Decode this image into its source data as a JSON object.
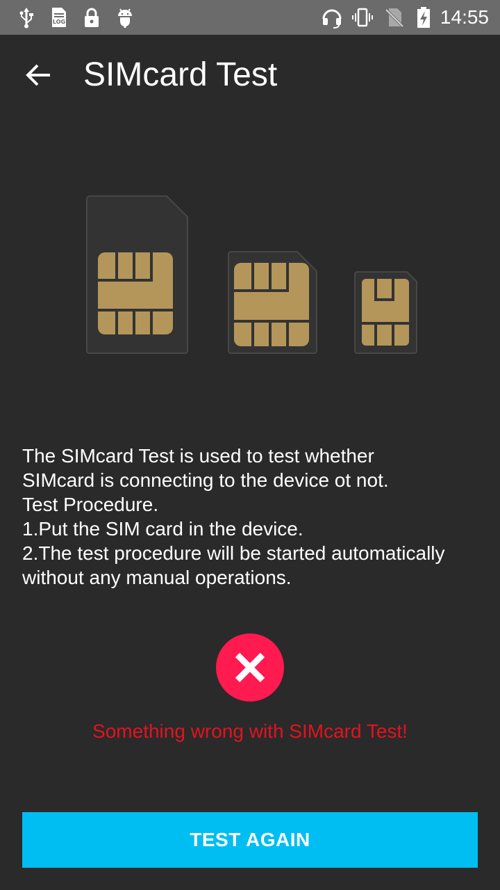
{
  "status_bar": {
    "time": "14:55",
    "left_icons": [
      "usb-icon",
      "log-icon",
      "lock-icon",
      "android-debug-icon"
    ],
    "right_icons": [
      "headset-icon",
      "vibrate-icon",
      "no-sim-icon",
      "battery-charging-icon"
    ]
  },
  "app_bar": {
    "back_icon": "arrow-back-icon",
    "title": "SIMcard Test"
  },
  "illustration": {
    "items": [
      "standard-sim-icon",
      "micro-sim-icon",
      "nano-sim-icon"
    ],
    "chip_color": "#b4965a",
    "card_color": "#333333"
  },
  "description": {
    "lines": [
      "The SIMcard Test is used to test whether",
      "SIMcard is connecting to the device ot not.",
      "Test Procedure.",
      "1.Put the SIM card in the device.",
      "2.The test procedure will be started automatically",
      "without any manual operations."
    ]
  },
  "result": {
    "icon": "error-x-icon",
    "icon_color": "#ff1a4f",
    "message": "Something wrong with SIMcard Test!",
    "message_color": "#e5121f"
  },
  "action": {
    "button_label": "TEST AGAIN",
    "button_color": "#00bdf2"
  }
}
